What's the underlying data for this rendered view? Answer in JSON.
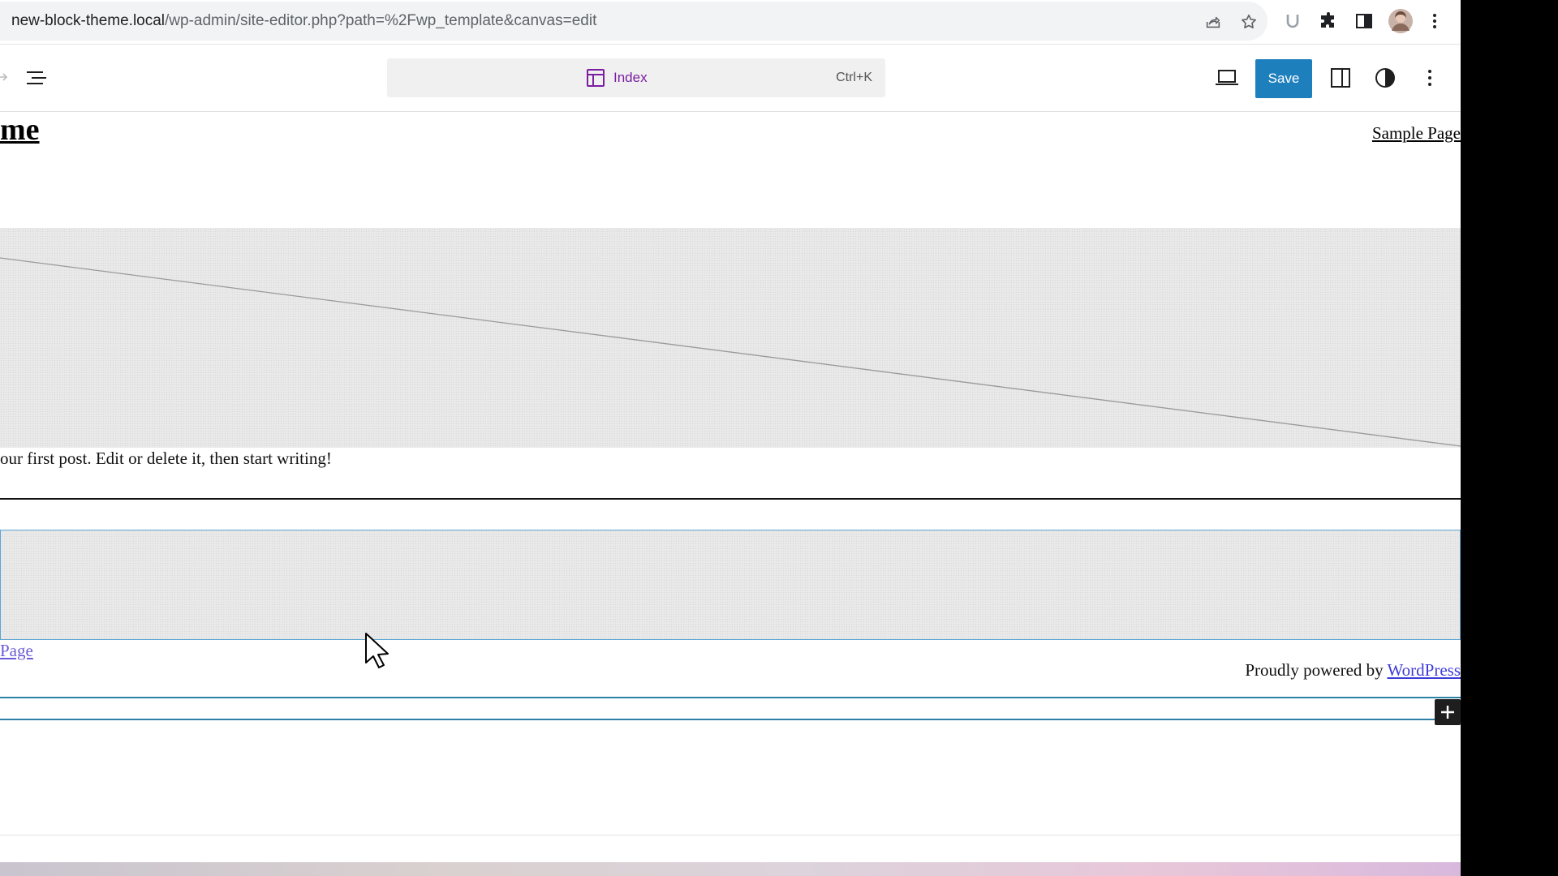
{
  "browser": {
    "url_host": "new-block-theme.local",
    "url_path": "/wp-admin/site-editor.php?path=%2Fwp_template&canvas=edit"
  },
  "editor": {
    "command_bar": {
      "title": "Index",
      "shortcut": "Ctrl+K"
    },
    "save_label": "Save",
    "accent_color": "#1e7fbd"
  },
  "canvas": {
    "site_title": "me",
    "nav_link": "Sample Page",
    "post_excerpt": "our first post. Edit or delete it, then start writing!",
    "page_link": "Page",
    "footer_text": "Proudly powered by",
    "footer_link": "WordPress"
  }
}
